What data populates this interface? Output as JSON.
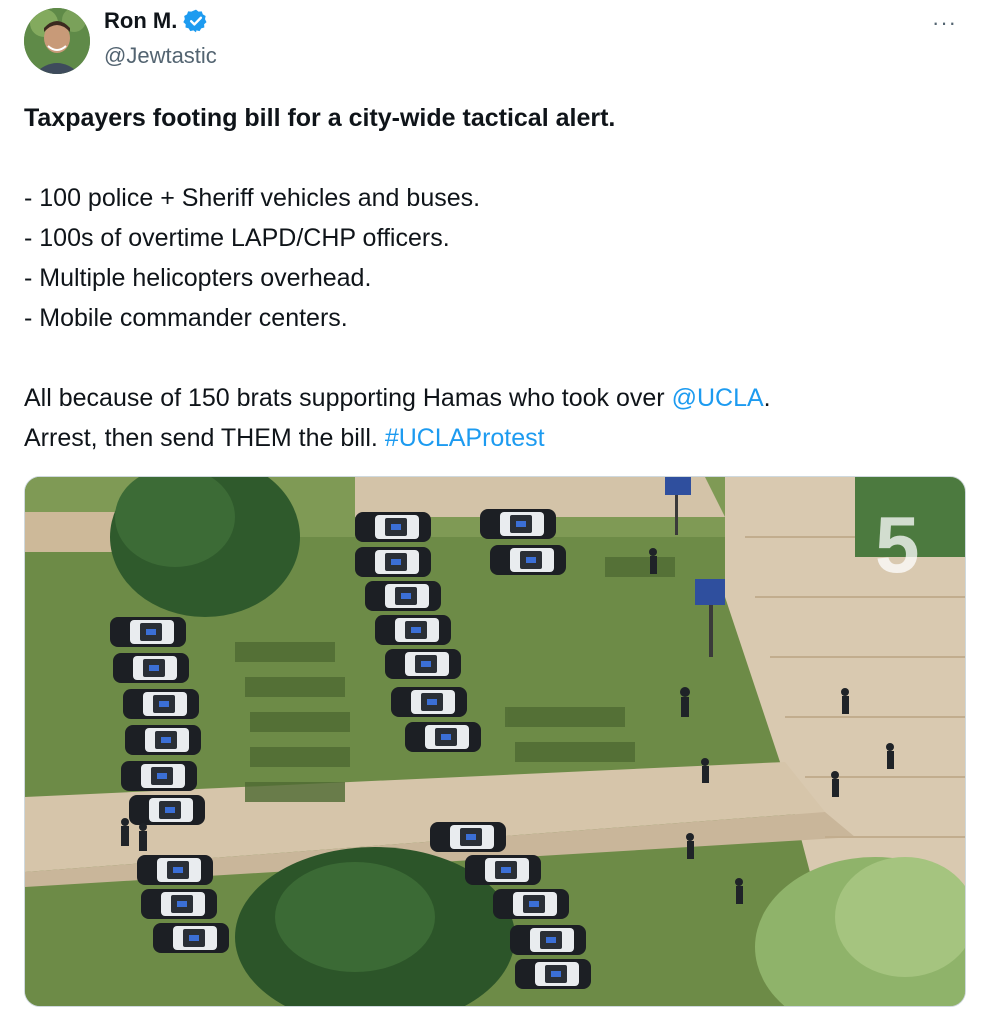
{
  "author": {
    "display_name": "Ron M.",
    "handle": "@Jewtastic",
    "verified": true,
    "avatar_icon": "user-avatar"
  },
  "menu": {
    "more_label": "···"
  },
  "tweet": {
    "headline": "Taxpayers footing bill for a city-wide tactical alert.",
    "bullets": [
      "- 100 police + Sheriff vehicles and buses.",
      "- 100s of overtime LAPD/CHP officers.",
      "- Multiple helicopters overhead.",
      "- Mobile commander centers."
    ],
    "para1_before": "All because of 150 brats supporting Hamas who took over ",
    "mention": "@UCLA",
    "para1_after": ".",
    "para2_before": "Arrest, then send THEM the bill. ",
    "hashtag": "#UCLAProtest"
  },
  "colors": {
    "link": "#1d9bf0",
    "verified": "#1d9bf0",
    "text": "#0f1419",
    "secondary": "#536471"
  },
  "media": {
    "type": "video-still",
    "overlay_text": "5"
  }
}
